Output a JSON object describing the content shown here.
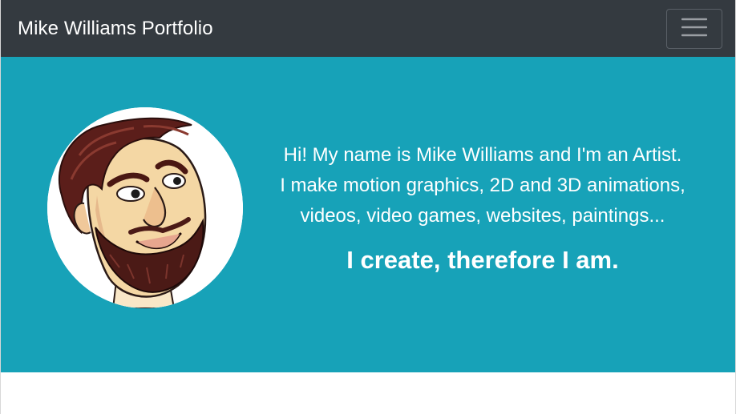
{
  "navbar": {
    "brand": "Mike Williams Portfolio",
    "toggler_icon": "hamburger-menu-icon"
  },
  "hero": {
    "avatar_icon": "caricature-portrait",
    "intro_lines": [
      "Hi! My name is Mike Williams and I'm an Artist.",
      "I make motion graphics, 2D and 3D animations,",
      "videos, video games, websites, paintings..."
    ],
    "tagline": "I create, therefore I am."
  },
  "colors": {
    "navbar_bg": "#343a40",
    "hero_bg": "#17a2b8",
    "text": "#ffffff",
    "page_bg": "#ffffff"
  }
}
